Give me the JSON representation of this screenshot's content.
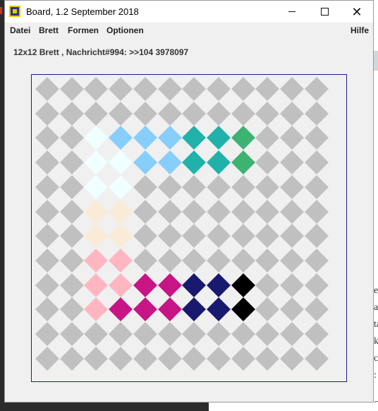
{
  "window": {
    "title": "Board, 1.2 September 2018",
    "controls": {
      "minimize": "minimize-icon",
      "maximize": "maximize-icon",
      "close": "close-icon"
    }
  },
  "menubar": {
    "items": [
      "Datei",
      "Brett",
      "Formen",
      "Optionen"
    ],
    "help": "Hilfe"
  },
  "status": {
    "text": "12x12 Brett , Nachricht#994: >>104 3978097"
  },
  "board": {
    "rows": 12,
    "cols": 12,
    "border_color": "#1b1b8a",
    "empty_color": "#c0c0c0",
    "colored_cells": [
      {
        "r": 2,
        "c": 2,
        "color": "#f0ffff"
      },
      {
        "r": 3,
        "c": 2,
        "color": "#f0ffff"
      },
      {
        "r": 3,
        "c": 3,
        "color": "#f0ffff"
      },
      {
        "r": 4,
        "c": 2,
        "color": "#f0ffff"
      },
      {
        "r": 4,
        "c": 3,
        "color": "#f0ffff"
      },
      {
        "r": 2,
        "c": 3,
        "color": "#87cefa"
      },
      {
        "r": 2,
        "c": 4,
        "color": "#87cefa"
      },
      {
        "r": 2,
        "c": 5,
        "color": "#87cefa"
      },
      {
        "r": 3,
        "c": 4,
        "color": "#87cefa"
      },
      {
        "r": 3,
        "c": 5,
        "color": "#87cefa"
      },
      {
        "r": 2,
        "c": 6,
        "color": "#20b2aa"
      },
      {
        "r": 2,
        "c": 7,
        "color": "#20b2aa"
      },
      {
        "r": 3,
        "c": 6,
        "color": "#20b2aa"
      },
      {
        "r": 3,
        "c": 7,
        "color": "#20b2aa"
      },
      {
        "r": 2,
        "c": 8,
        "color": "#3cb371"
      },
      {
        "r": 3,
        "c": 8,
        "color": "#3cb371"
      },
      {
        "r": 5,
        "c": 2,
        "color": "#faebd7"
      },
      {
        "r": 5,
        "c": 3,
        "color": "#faebd7"
      },
      {
        "r": 6,
        "c": 2,
        "color": "#faebd7"
      },
      {
        "r": 6,
        "c": 3,
        "color": "#faebd7"
      },
      {
        "r": 7,
        "c": 2,
        "color": "#ffb6c1"
      },
      {
        "r": 7,
        "c": 3,
        "color": "#ffb6c1"
      },
      {
        "r": 8,
        "c": 2,
        "color": "#ffb6c1"
      },
      {
        "r": 8,
        "c": 3,
        "color": "#ffb6c1"
      },
      {
        "r": 9,
        "c": 2,
        "color": "#ffb6c1"
      },
      {
        "r": 8,
        "c": 4,
        "color": "#c71585"
      },
      {
        "r": 8,
        "c": 5,
        "color": "#c71585"
      },
      {
        "r": 9,
        "c": 3,
        "color": "#c71585"
      },
      {
        "r": 9,
        "c": 4,
        "color": "#c71585"
      },
      {
        "r": 9,
        "c": 5,
        "color": "#c71585"
      },
      {
        "r": 8,
        "c": 6,
        "color": "#191970"
      },
      {
        "r": 8,
        "c": 7,
        "color": "#191970"
      },
      {
        "r": 9,
        "c": 6,
        "color": "#191970"
      },
      {
        "r": 9,
        "c": 7,
        "color": "#191970"
      },
      {
        "r": 8,
        "c": 8,
        "color": "#000000"
      },
      {
        "r": 9,
        "c": 8,
        "color": "#000000"
      }
    ]
  },
  "background_right": {
    "lines": [
      "e",
      "a",
      "ta",
      "k",
      "ci",
      ":",
      "Sp"
    ]
  }
}
